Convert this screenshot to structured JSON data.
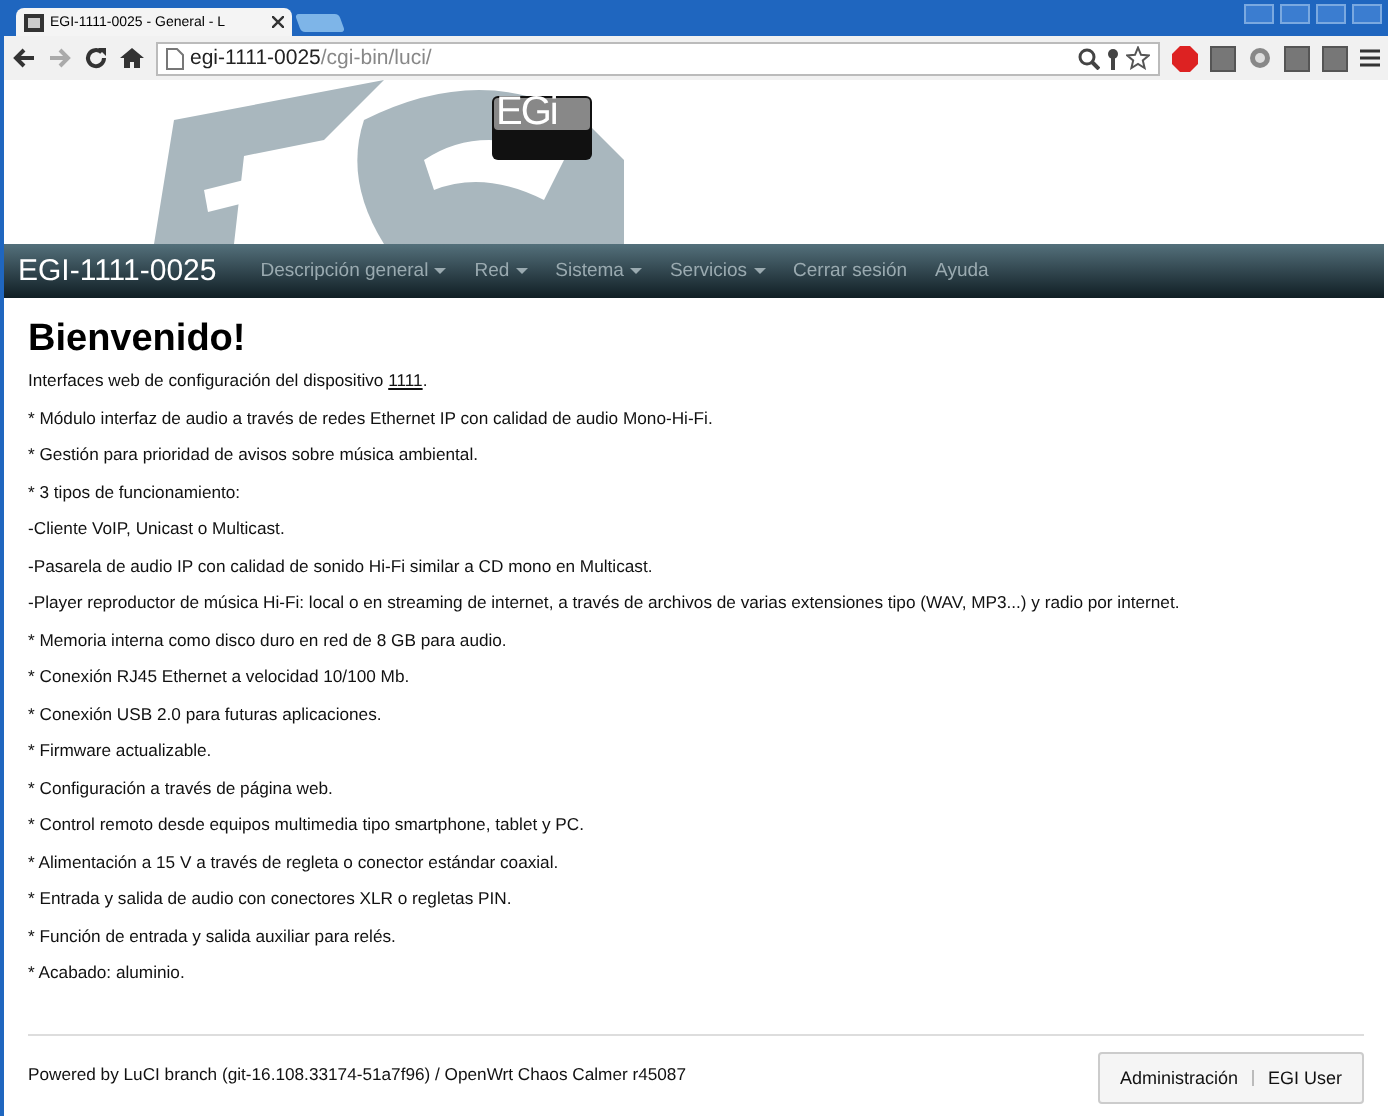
{
  "browser": {
    "tab_title": "EGI-1111-0025 - General - L",
    "url_host": "egi-1111-0025",
    "url_path": "/cgi-bin/luci/"
  },
  "logo": {
    "text": "EGi"
  },
  "navbar": {
    "brand": "EGI-1111-0025",
    "items": [
      {
        "label": "Descripción general",
        "dropdown": true
      },
      {
        "label": "Red",
        "dropdown": true
      },
      {
        "label": "Sistema",
        "dropdown": true
      },
      {
        "label": "Servicios",
        "dropdown": true
      },
      {
        "label": "Cerrar sesión",
        "dropdown": false
      },
      {
        "label": "Ayuda",
        "dropdown": false
      }
    ]
  },
  "heading": "Bienvenido!",
  "intro": {
    "text": "Interfaces web de configuración del dispositivo ",
    "link": "1111",
    "after": "."
  },
  "lines": [
    "* Módulo interfaz de audio a través de redes Ethernet IP con calidad de audio Mono-Hi-Fi.",
    "* Gestión para prioridad de avisos sobre música ambiental.",
    "* 3 tipos de funcionamiento:",
    "-Cliente VoIP, Unicast o Multicast.",
    "-Pasarela de audio IP con calidad de sonido Hi-Fi similar a CD mono en Multicast.",
    "-Player reproductor de música Hi-Fi: local o en streaming de internet, a través de archivos de varias extensiones tipo (WAV, MP3...) y radio por internet.",
    "* Memoria interna como disco duro en red de 8 GB para audio.",
    "* Conexión RJ45 Ethernet a velocidad 10/100 Mb.",
    "* Conexión USB 2.0 para futuras aplicaciones.",
    "* Firmware actualizable.",
    "* Configuración a través de página web.",
    "* Control remoto desde equipos multimedia tipo smartphone, tablet y PC.",
    "* Alimentación a 15 V a través de regleta o conector estándar coaxial.",
    "* Entrada y salida de audio con conectores XLR o regletas PIN.",
    "* Función de entrada y salida auxiliar para relés.",
    "* Acabado: aluminio."
  ],
  "footer": {
    "text": "Powered by LuCI branch (git-16.108.33174-51a7f96) / OpenWrt Chaos Calmer r45087",
    "buttons": [
      "Administración",
      "EGI User"
    ]
  }
}
